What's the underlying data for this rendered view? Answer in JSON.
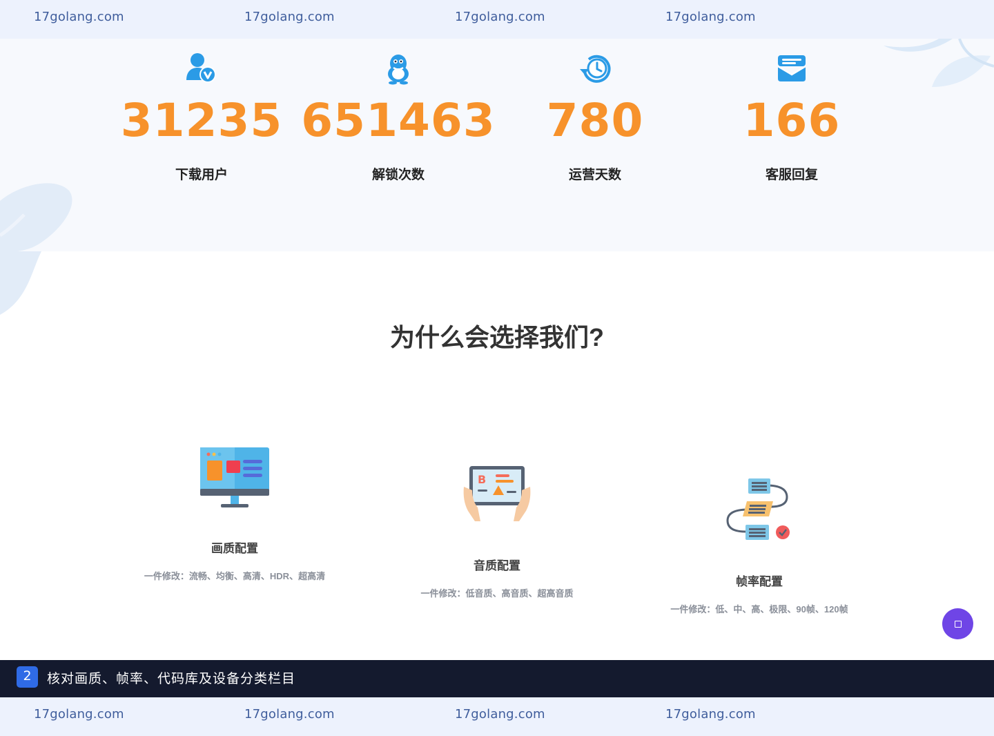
{
  "watermark": {
    "text": "17golang.com",
    "top": [
      "17golang.com",
      "17golang.com",
      "17golang.com",
      "17golang.com"
    ],
    "bottom": [
      "17golang.com",
      "17golang.com",
      "17golang.com",
      "17golang.com"
    ]
  },
  "stats": [
    {
      "icon": "verified-user-icon",
      "value": "31235",
      "label": "下载用户"
    },
    {
      "icon": "qq-penguin-icon",
      "value": "651463",
      "label": "解锁次数"
    },
    {
      "icon": "clock-history-icon",
      "value": "780",
      "label": "运营天数"
    },
    {
      "icon": "mail-icon",
      "value": "166",
      "label": "客服回复"
    }
  ],
  "why": {
    "title": "为什么会选择我们?",
    "features": [
      {
        "icon": "monitor-dashboard-icon",
        "title": "画质配置",
        "desc": "一件修改：流畅、均衡、高清、HDR、超高清"
      },
      {
        "icon": "tablet-hands-icon",
        "title": "音质配置",
        "desc": "一件修改：低音质、高音质、超高音质"
      },
      {
        "icon": "workflow-list-icon",
        "title": "帧率配置",
        "desc": "一件修改：低、中、高、极限、90帧、120帧"
      }
    ]
  },
  "caption": {
    "step": "2",
    "text": "核对画质、帧率、代码库及设备分类栏目"
  },
  "colors": {
    "accent_orange": "#f7922b",
    "icon_blue": "#2b9be6",
    "caption_bg": "#141a2e",
    "step_badge": "#2f6be6",
    "float_button": "#6f45e6"
  }
}
